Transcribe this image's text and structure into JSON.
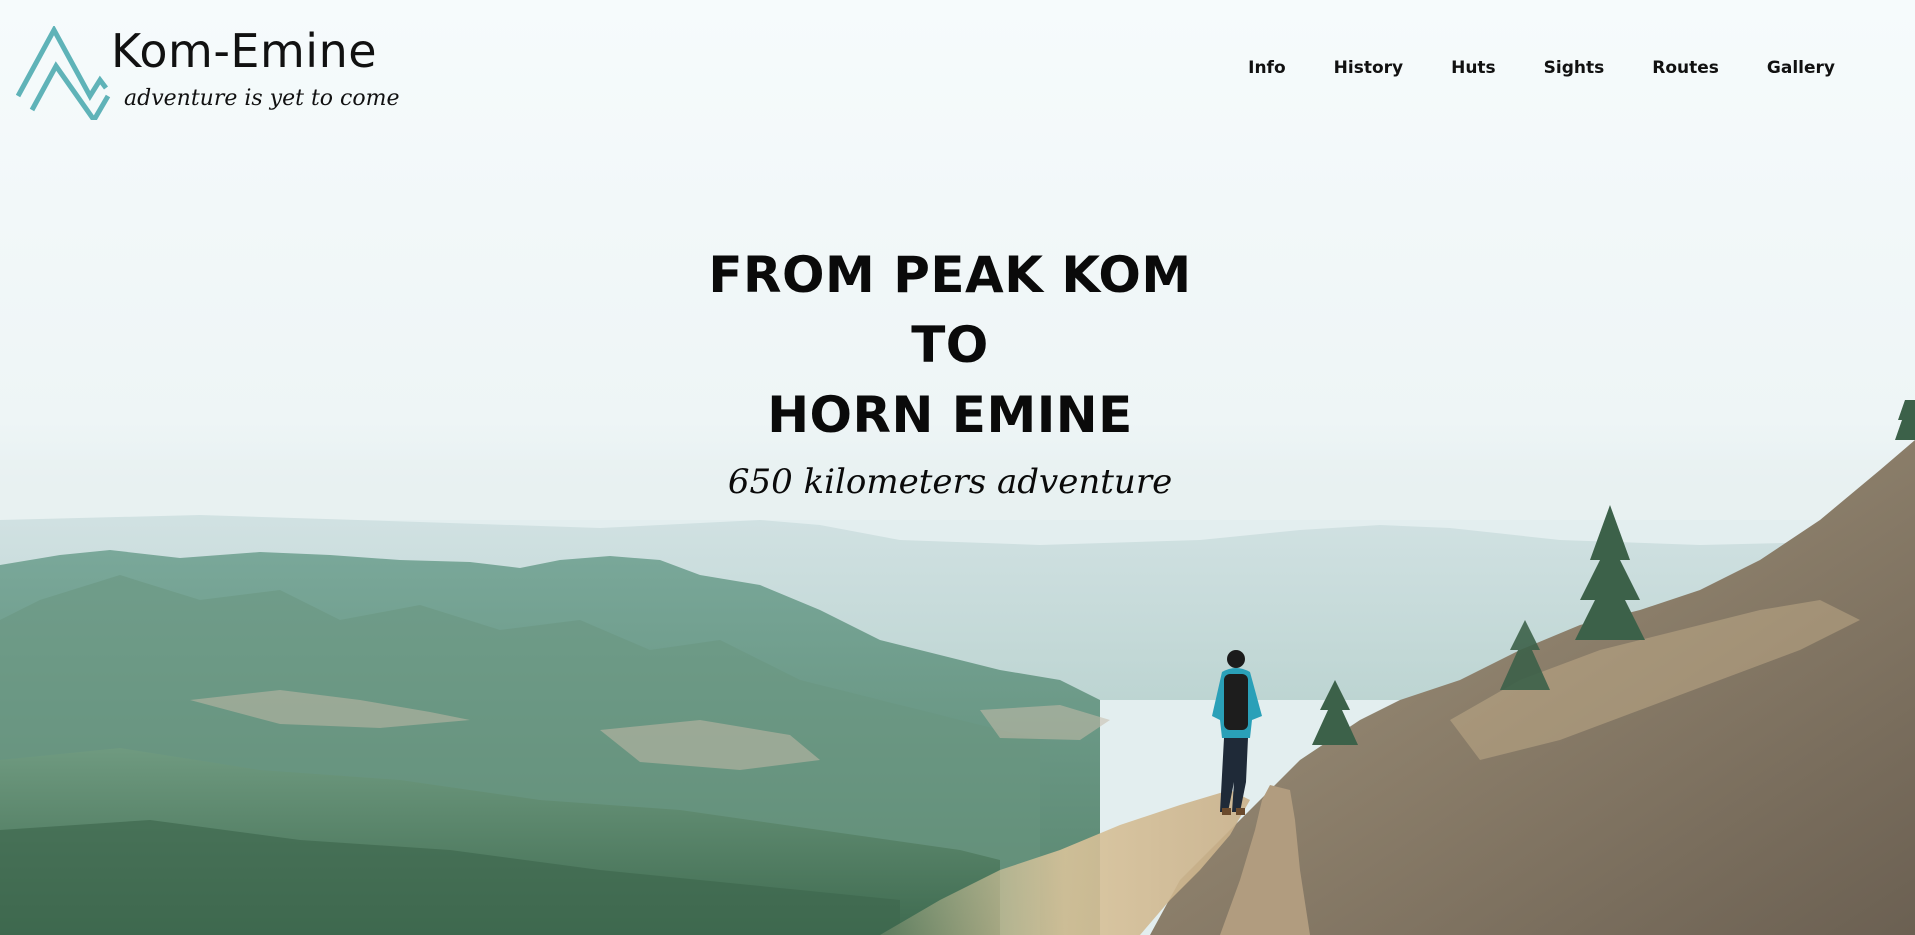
{
  "logo": {
    "icon": "mountain-peak-icon",
    "title": "Kom-Emine",
    "tagline": "adventure is yet to come",
    "accent_color": "#5fb3b8"
  },
  "nav": {
    "items": [
      {
        "label": "Info"
      },
      {
        "label": "History"
      },
      {
        "label": "Huts"
      },
      {
        "label": "Sights"
      },
      {
        "label": "Routes"
      },
      {
        "label": "Gallery"
      }
    ]
  },
  "hero": {
    "headline_line1": "FROM PEAK KOM",
    "headline_line2": "TO",
    "headline_line3": "HORN EMINE",
    "subtitle": "650 kilometers adventure",
    "background": "mountain-landscape-hiker-photo"
  }
}
